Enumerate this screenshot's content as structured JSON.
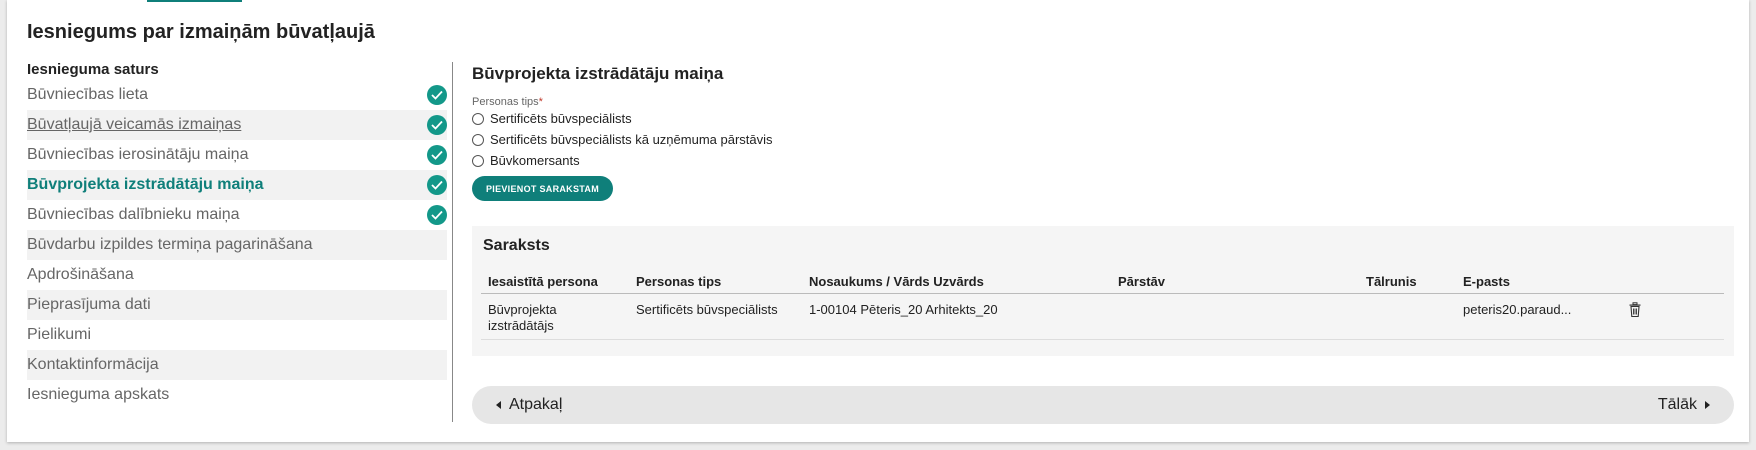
{
  "page": {
    "title": "Iesniegums par izmaiņām būvatļaujā"
  },
  "colors": {
    "accent": "#0f7f7a",
    "check": "#139889",
    "panel": "#f5f5f5",
    "required": "#c0392b"
  },
  "nav": {
    "heading": "Iesnieguma saturs",
    "items": [
      {
        "label": "Būvniecības lieta",
        "completed": true
      },
      {
        "label": "Būvatļaujā veicamās izmaiņas",
        "completed": true
      },
      {
        "label": "Būvniecības ierosinātāju maiņa",
        "completed": true
      },
      {
        "label": "Būvprojekta izstrādātāju maiņa",
        "completed": true,
        "current": true
      },
      {
        "label": "Būvniecības dalībnieku maiņa",
        "completed": true
      },
      {
        "label": "Būvdarbu izpildes termiņa pagarināšana",
        "completed": false
      },
      {
        "label": "Apdrošināšana",
        "completed": false
      },
      {
        "label": "Pieprasījuma dati",
        "completed": false
      },
      {
        "label": "Pielikumi",
        "completed": false
      },
      {
        "label": "Kontaktinformācija",
        "completed": false
      },
      {
        "label": "Iesnieguma apskats",
        "completed": false
      }
    ]
  },
  "form": {
    "section_title": "Būvprojekta izstrādātāju maiņa",
    "person_type_label": "Personas tips",
    "required_marker": "*",
    "options": [
      "Sertificēts būvspeciālists",
      "Sertificēts būvspeciālists kā uzņēmuma pārstāvis",
      "Būvkomersants"
    ],
    "add_button": "PIEVIENOT SARAKSTAM"
  },
  "list": {
    "title": "Saraksts",
    "columns": [
      "Iesaistītā persona",
      "Personas tips",
      "Nosaukums / Vārds Uzvārds",
      "Pārstāv",
      "Tālrunis",
      "E-pasts"
    ],
    "rows": [
      {
        "role": "Būvprojekta izstrādātājs",
        "person_type": "Sertificēts būvspeciālists",
        "name": "1-00104 Pēteris_20 Arhitekts_20",
        "represents": "",
        "phone": "",
        "email": "peteris20.paraud...",
        "delete_icon": "trash-icon"
      }
    ]
  },
  "footer": {
    "back_label": "Atpakaļ",
    "next_label": "Tālāk"
  }
}
